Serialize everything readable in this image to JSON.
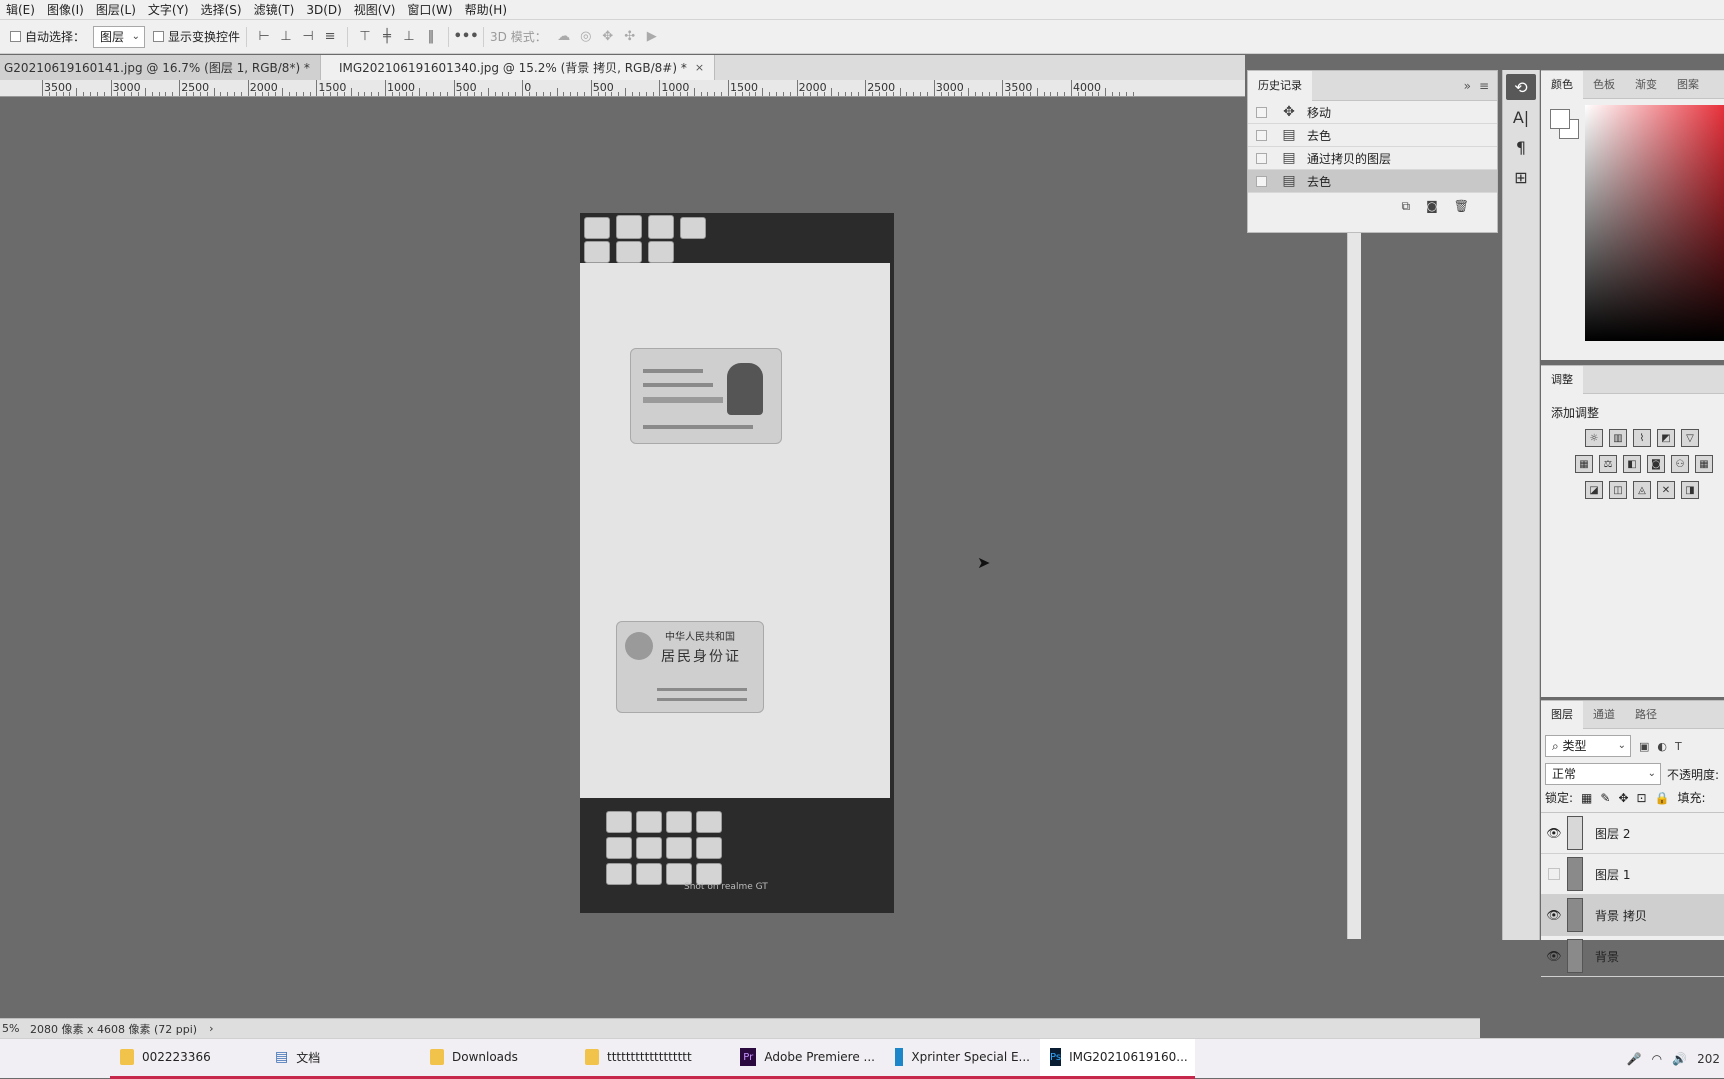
{
  "menus": [
    "辑(E)",
    "图像(I)",
    "图层(L)",
    "文字(Y)",
    "选择(S)",
    "滤镜(T)",
    "3D(D)",
    "视图(V)",
    "窗口(W)",
    "帮助(H)"
  ],
  "options": {
    "auto_select_label": "自动选择：",
    "auto_select_value": "图层",
    "show_transform_label": "显示变换控件",
    "more": "•••",
    "mode_3d": "3D 模式："
  },
  "tabs": [
    {
      "label": "G20210619160141.jpg @ 16.7% (图层 1, RGB/8*) *",
      "close": "×"
    },
    {
      "label": "IMG202106191601340.jpg @ 15.2% (背景 拷贝, RGB/8#) *",
      "close": "×"
    }
  ],
  "ruler_labels": [
    "3500",
    "3000",
    "2500",
    "2000",
    "1500",
    "1000",
    "500",
    "0",
    "500",
    "1000",
    "1500",
    "2000",
    "2500",
    "3000",
    "3500",
    "4000"
  ],
  "history": {
    "title": "历史记录",
    "collapse": "»",
    "items": [
      {
        "label": "移动",
        "icon": "move-icon",
        "glyph": "✥"
      },
      {
        "label": "去色",
        "icon": "document-icon",
        "glyph": "▤"
      },
      {
        "label": "通过拷贝的图层",
        "icon": "document-icon",
        "glyph": "▤"
      },
      {
        "label": "去色",
        "icon": "document-icon",
        "glyph": "▤"
      }
    ]
  },
  "color_panel": {
    "tabs": [
      "颜色",
      "色板",
      "渐变",
      "图案"
    ]
  },
  "adjust_panel": {
    "tab": "调整",
    "add_label": "添加调整"
  },
  "layers_panel": {
    "tabs": [
      "图层",
      "通道",
      "路径"
    ],
    "filter_kind": "类型",
    "blend_mode": "正常",
    "opacity_label": "不透明度:",
    "lock_label": "锁定:",
    "fill_label": "填充:",
    "layers": [
      {
        "name": "图层 2",
        "visible": true,
        "selected": false
      },
      {
        "name": "图层 1",
        "visible": false,
        "selected": false
      },
      {
        "name": "背景 拷贝",
        "visible": true,
        "selected": true
      },
      {
        "name": "背景",
        "visible": true,
        "selected": false
      }
    ]
  },
  "status": {
    "zoom": "5%",
    "doc_size": "2080 像素 x 4608 像素 (72 ppi)",
    "arrow": "›"
  },
  "document": {
    "id_front_title_1": "中华人民共和国",
    "id_front_title_2": "居民身份证",
    "watermark": "Shot on realme GT"
  },
  "taskbar": {
    "items": [
      {
        "label": "002223366",
        "icon": "folder-icon"
      },
      {
        "label": "文档",
        "icon": "document-icon"
      },
      {
        "label": "Downloads",
        "icon": "folder-icon"
      },
      {
        "label": "tttttttttttttttttt",
        "icon": "folder-icon"
      },
      {
        "label": "Adobe Premiere ...",
        "icon": "premiere-icon"
      },
      {
        "label": "Xprinter Special E...",
        "icon": "xprinter-icon"
      },
      {
        "label": "IMG20210619160...",
        "icon": "photoshop-icon"
      }
    ],
    "clock": "202"
  }
}
